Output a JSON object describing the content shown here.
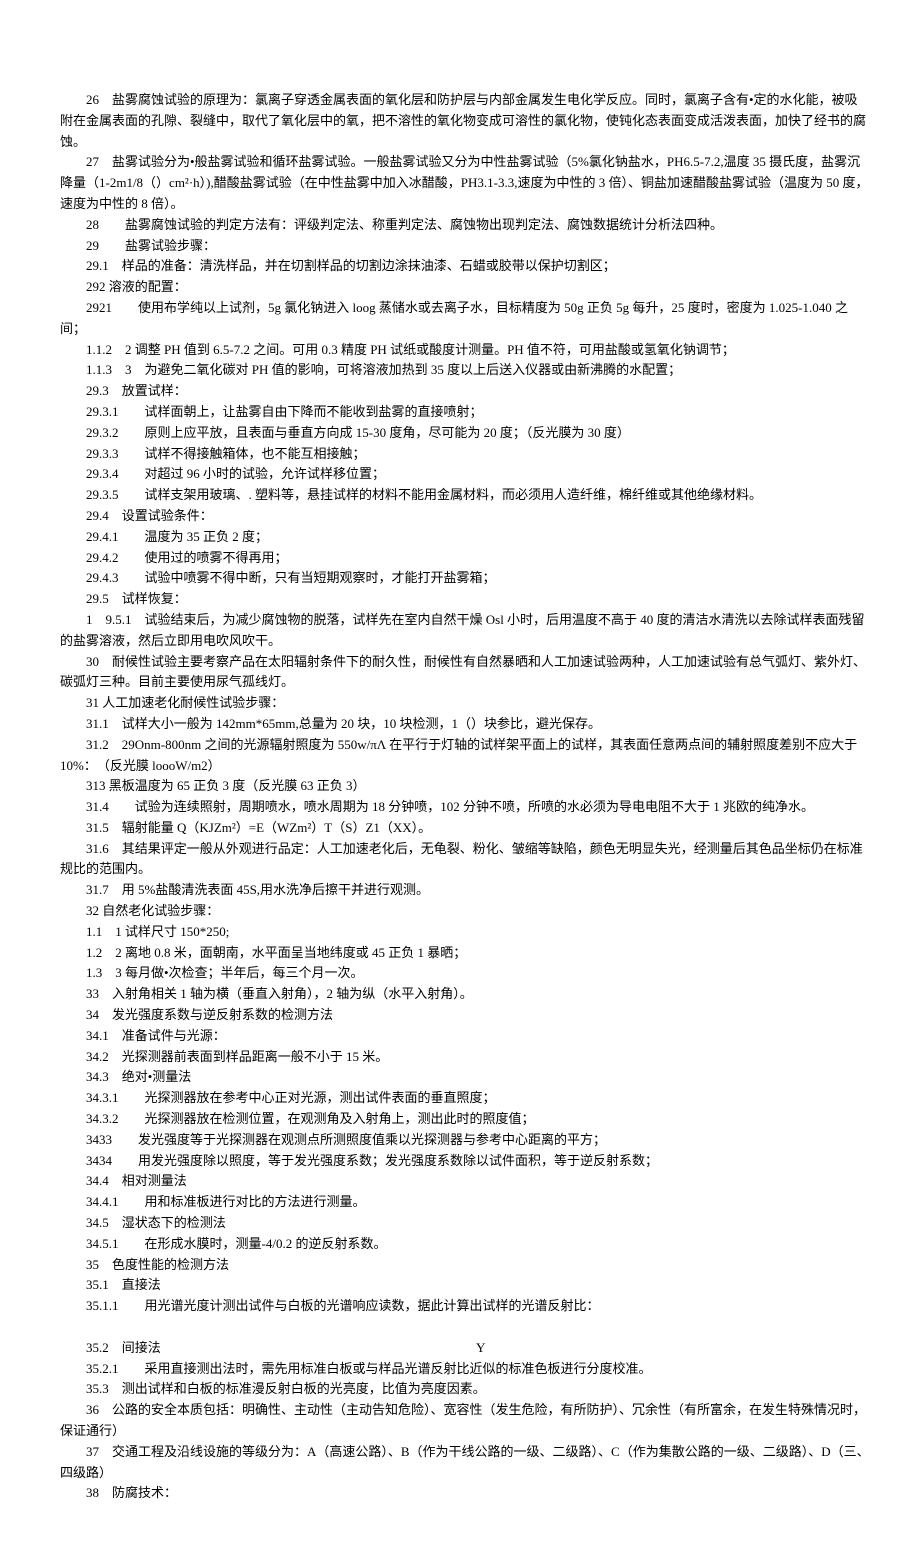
{
  "p26": "26　盐雾腐蚀试验的原理为：氯离子穿透金属表面的氧化层和防护层与内部金属发生电化学反应。同时，氯离子含有•定的水化能，被吸附在金属表面的孔隙、裂缝中，取代了氧化层中的氧，把不溶性的氧化物变成可溶性的氯化物，使钝化态表面变成活泼表面，加快了经书的腐蚀。",
  "p27": "27　盐雾试验分为•般盐雾试验和循环盐雾试验。一般盐雾试验又分为中性盐雾试验（5%氯化钠盐水，PH6.5-7.2,温度 35 摄氏度，盐雾沉降量（1-2m1/8（）cm²·h）),醋酸盐雾试验（在中性盐雾中加入冰醋酸，PH3.1-3.3,速度为中性的 3 倍）、铜盐加速醋酸盐雾试验（温度为 50 度，速度为中性的 8 倍）。",
  "p28": "28　　盐雾腐蚀试验的判定方法有：评级判定法、称重判定法、腐蚀物出现判定法、腐蚀数据统计分析法四种。",
  "p29": "29　　盐雾试验步骤：",
  "p29_1": "29.1　样品的准备：清洗样品，并在切割样品的切割边涂抹油漆、石蜡或胶带以保护切割区；",
  "p292": "292 溶液的配置：",
  "p2921": "2921　　使用布学纯以上试剂，5g 氯化钠进入 loog 蒸储水或去离子水，目标精度为 50g 正负 5g 每升，25 度时，密度为 1.025-1.040 之间；",
  "p1_1_2": "1.1.2　2 调整 PH 值到 6.5-7.2 之间。可用 0.3 精度 PH 试纸或酸度计测量。PH 值不符，可用盐酸或氢氧化钠调节；",
  "p1_1_3": "1.1.3　3　为避免二氧化碳对 PH 值的影响，可将溶液加热到 35 度以上后送入仪器或由新沸腾的水配置；",
  "p29_3": "29.3　放置试样：",
  "p29_3_1": "29.3.1　　试样面朝上，让盐雾自由下降而不能收到盐雾的直接喷射；",
  "p29_3_2": "29.3.2　　原则上应平放，且表面与垂直方向成 15-30 度角，尽可能为 20 度；（反光膜为 30 度）",
  "p29_3_3": "29.3.3　　试样不得接触箱体，也不能互相接触；",
  "p29_3_4": "29.3.4　　对超过 96 小时的试验，允许试样移位置；",
  "p29_3_5": "29.3.5　　试样支架用玻璃、. 塑料等，悬挂试样的材料不能用金属材料，而必须用人造纤维，棉纤维或其他绝缘材料。",
  "p29_4": "29.4　设置试验条件：",
  "p29_4_1": "29.4.1　　温度为 35 正负 2 度；",
  "p29_4_2": "29.4.2　　使用过的喷雾不得再用；",
  "p29_4_3": "29.4.3　　试验中喷雾不得中断，只有当短期观察时，才能打开盐雾箱；",
  "p29_5": "29.5　试样恢复：",
  "p1_9_5_1": "1　9.5.1　试验结束后，为减少腐蚀物的脱落，试样先在室内自然干燥 Osl 小时，后用温度不高于 40 度的清洁水清洗以去除试样表面残留的盐雾溶液，然后立即用电吹风吹干。",
  "p30": "30　耐候性试验主要考察产品在太阳辐射条件下的耐久性，耐候性有自然暴晒和人工加速试验两种，人工加速试验有总气弧灯、紫外灯、碳弧灯三种。目前主要使用尿气孤线灯。",
  "p31": "31 人工加速老化耐候性试验步骤：",
  "p31_1": "31.1　试样大小一般为 142mm*65mm,总量为 20 块，10 块检测，1（）块参比，避光保存。",
  "p31_2": "31.2　29Onm-800nm 之间的光源辐射照度为 550w/πΛ 在平行于灯轴的试样架平面上的试样，其表面任意两点间的辅射照度差别不应大于 10%：　（反光膜 loooW/m2）",
  "p313": "313 黑板温度为 65 正负 3 度（反光膜 63 正负 3）",
  "p31_4": "31.4　　试验为连续照射，周期喷水，喷水周期为 18 分钟喷，102 分钟不喷，所喷的水必须为导电电阻不大于 1 兆欧的纯净水。",
  "p31_5": "31.5　辐射能量 Q（KJZm²）=E（WZm²）T（S）Z1（XX）。",
  "p31_6": "31.6　其结果评定一般从外观进行品定：人工加速老化后，无龟裂、粉化、皱缩等缺陷，颜色无明显失光，经测量后其色品坐标仍在标准规比的范围内。",
  "p31_7": "31.7　用 5%盐酸清洗表面 45S,用水洗净后擦干并进行观测。",
  "p32": "32 自然老化试验步骤：",
  "p1_1": "1.1　1 试样尺寸 150*250;",
  "p1_2": "1.2　2 离地 0.8 米，面朝南，水平面呈当地纬度或 45 正负 1 暴晒；",
  "p1_3": "1.3　3 每月做•次检查；半年后，每三个月一次。",
  "p33": "33　入射角相关 1 轴为横（垂直入射角），2 轴为纵（水平入射角）。",
  "p34": "34　发光强度系数与逆反射系数的检测方法",
  "p34_1": "34.1　准备试件与光源：",
  "p34_2": "34.2　光探测器前表面到样品距离一般不小于 15 米。",
  "p34_3": "34.3　绝对•测量法",
  "p34_3_1": "34.3.1　　光探测器放在参考中心正对光源，测出试件表面的垂直照度；",
  "p34_3_2": "34.3.2　　光探测器放在检测位置，在观测角及入射角上，测出此时的照度值；",
  "p3433": "3433　　发光强度等于光探测器在观测点所测照度值乘以光探测器与参考中心距离的平方；",
  "p3434": "3434　　用发光强度除以照度，等于发光强度系数；发光强度系数除以试件面积，等于逆反射系数；",
  "p34_4": "34.4　相对测量法",
  "p34_4_1": "34.4.1　　用和标准板进行对比的方法进行测量。",
  "p34_5": "34.5　湿状态下的检测法",
  "p34_5_1": "34.5.1　　在形成水膜时，测量-4/0.2 的逆反射系数。",
  "p35": "35　色度性能的检测方法",
  "p35_1": "35.1　直接法",
  "p35_1_1": "35.1.1　　用光谱光度计测出试件与白板的光谱响应读数，据此计算出试样的光谱反射比：",
  "p35_2_label": "35.2　间接法",
  "p35_2_y": "Y",
  "p35_2_1": "35.2.1　　采用直接测出法时，需先用标准白板或与样品光谱反射比近似的标准色板进行分度校准。",
  "p35_3": "35.3　测出试样和白板的标准漫反射白板的光亮度，比值为亮度因素。",
  "p36": "36　公路的安全本质包括：明确性、主动性（主动告知危险）、宽容性（发生危险，有所防护）、冗余性（有所富余，在发生特殊情况时，保证通行）",
  "p37": "37　交通工程及沿线设施的等级分为：A（高速公路）、B（作为干线公路的一级、二级路）、C（作为集散公路的一级、二级路）、D（三、四级路）",
  "p38": "38　防腐技术："
}
